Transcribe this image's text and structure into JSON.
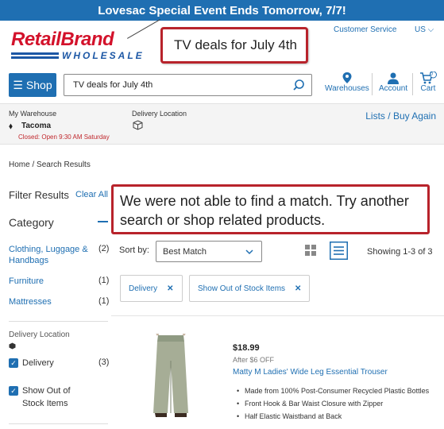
{
  "promo": {
    "text": "Lovesac Special Event Ends Tomorrow, 7/7!"
  },
  "header": {
    "logo_main": "RetailBrand",
    "logo_sub": "WHOLESALE",
    "customer_service": "Customer Service",
    "language": "US",
    "shop_label": "Shop",
    "search_value": "TV deals for July 4th",
    "warehouses": "Warehouses",
    "account": "Account",
    "cart": "Cart",
    "cart_count": "0"
  },
  "annotation": {
    "search_callout": "TV deals for July 4th",
    "no_match_callout": "We were not able to find a match. Try another search or shop related products."
  },
  "subbar": {
    "warehouse_label": "My Warehouse",
    "warehouse_name": "Tacoma",
    "warehouse_hours": "Closed: Open 9:30 AM Saturday",
    "delivery_label": "Delivery Location",
    "lists_label": "Lists",
    "separator": "/",
    "buy_again_label": "Buy Again"
  },
  "breadcrumb": {
    "home": "Home",
    "sep": "/",
    "current": "Search Results"
  },
  "filters": {
    "title": "Filter Results",
    "clear_all": "Clear All",
    "category_title": "Category",
    "categories": [
      {
        "label": "Clothing, Luggage & Handbags",
        "count": "(2)"
      },
      {
        "label": "Furniture",
        "count": "(1)"
      },
      {
        "label": "Mattresses",
        "count": "(1)"
      }
    ],
    "delivery_location_title": "Delivery Location",
    "checks": [
      {
        "label": "Delivery",
        "count": "(3)"
      },
      {
        "label": "Show Out of Stock Items",
        "count": ""
      }
    ]
  },
  "toolbar": {
    "sort_label": "Sort by:",
    "sort_value": "Best Match",
    "showing": "Showing 1-3 of 3"
  },
  "chips": [
    {
      "label": "Delivery",
      "x": "✕"
    },
    {
      "label": "Show Out of Stock Items",
      "x": "✕"
    }
  ],
  "product": {
    "price": "$18.99",
    "discount": "After $6 OFF",
    "name": "Matty M Ladies' Wide Leg Essential Trouser",
    "bullets": [
      "Made from 100% Post-Consumer Recycled Plastic Bottles",
      "Front Hook & Bar Waist Closure with Zipper",
      "Half Elastic Waistband at Back"
    ]
  },
  "colors": {
    "brand_blue": "#1f6fb2",
    "brand_red": "#d3122b",
    "annotation_red": "#b8232b"
  }
}
